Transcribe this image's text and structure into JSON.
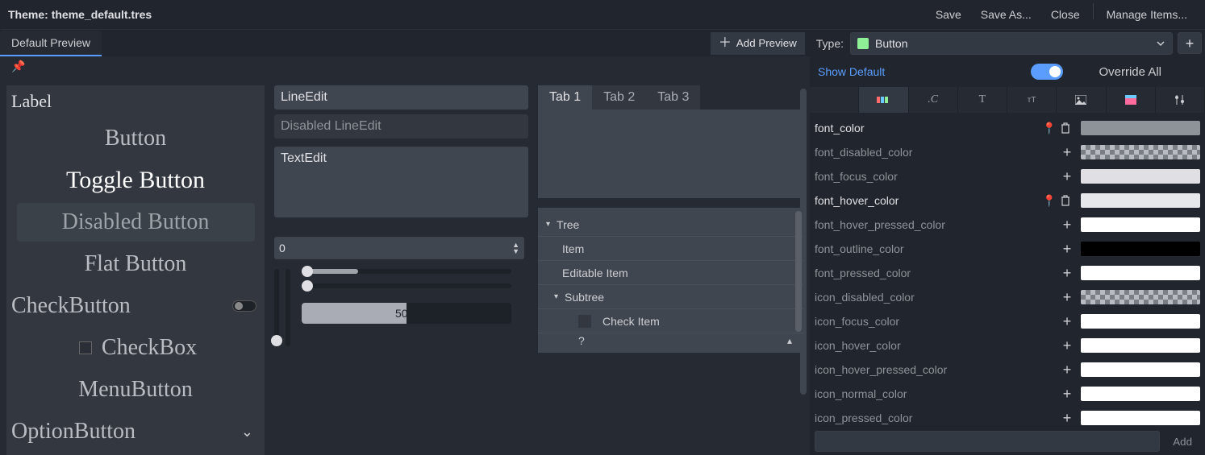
{
  "header": {
    "theme_prefix": "Theme: ",
    "theme_name": "theme_default.tres",
    "save": "Save",
    "save_as": "Save As...",
    "close": "Close",
    "manage": "Manage Items..."
  },
  "tab_bar": {
    "default_preview": "Default Preview",
    "add_preview": "Add Preview",
    "type_label": "Type:",
    "type_value": "Button",
    "add_type_plus": "+"
  },
  "preview": {
    "col1": {
      "label": "Label",
      "button": "Button",
      "toggle_button": "Toggle Button",
      "disabled_button": "Disabled Button",
      "flat_button": "Flat Button",
      "check_button": "CheckButton",
      "check_box": "CheckBox",
      "menu_button": "MenuButton",
      "option_button": "OptionButton"
    },
    "col2": {
      "line_edit": "LineEdit",
      "disabled_line_edit": "Disabled LineEdit",
      "text_edit": "TextEdit",
      "spin_value": "0",
      "progress_text": "50%"
    },
    "col3": {
      "tab1": "Tab 1",
      "tab2": "Tab 2",
      "tab3": "Tab 3",
      "tree": "Tree",
      "item": "Item",
      "editable_item": "Editable Item",
      "subtree": "Subtree",
      "check_item": "Check Item",
      "trailing": "?"
    }
  },
  "props": {
    "show_default": "Show Default",
    "override_all": "Override All",
    "rows": [
      {
        "name": "font_color",
        "overridden": true,
        "color": "#8e9299",
        "checker": false
      },
      {
        "name": "font_disabled_color",
        "overridden": false,
        "color": null,
        "checker": true
      },
      {
        "name": "font_focus_color",
        "overridden": false,
        "color": "#e0e0e4",
        "checker": false
      },
      {
        "name": "font_hover_color",
        "overridden": true,
        "color": "#e6e7ea",
        "checker": false
      },
      {
        "name": "font_hover_pressed_color",
        "overridden": false,
        "color": "#ffffff",
        "checker": false
      },
      {
        "name": "font_outline_color",
        "overridden": false,
        "color": "#000000",
        "checker": false
      },
      {
        "name": "font_pressed_color",
        "overridden": false,
        "color": "#ffffff",
        "checker": false
      },
      {
        "name": "icon_disabled_color",
        "overridden": false,
        "color": null,
        "checker": true
      },
      {
        "name": "icon_focus_color",
        "overridden": false,
        "color": "#ffffff",
        "checker": false
      },
      {
        "name": "icon_hover_color",
        "overridden": false,
        "color": "#ffffff",
        "checker": false
      },
      {
        "name": "icon_hover_pressed_color",
        "overridden": false,
        "color": "#ffffff",
        "checker": false
      },
      {
        "name": "icon_normal_color",
        "overridden": false,
        "color": "#ffffff",
        "checker": false
      },
      {
        "name": "icon_pressed_color",
        "overridden": false,
        "color": "#ffffff",
        "checker": false
      }
    ],
    "add_label": "Add"
  }
}
